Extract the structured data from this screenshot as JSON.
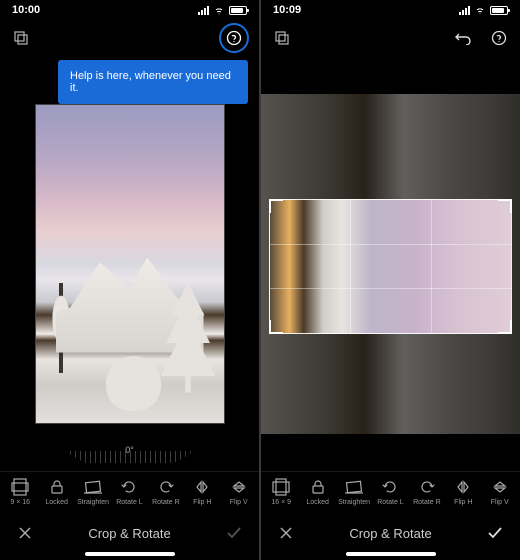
{
  "left": {
    "status_time": "10:00",
    "tooltip": "Help is here, whenever you need it.",
    "angle": "0°",
    "tools": [
      {
        "id": "aspect",
        "label": "9 × 16"
      },
      {
        "id": "locked",
        "label": "Locked"
      },
      {
        "id": "straighten",
        "label": "Straighten"
      },
      {
        "id": "rotate-l",
        "label": "Rotate L"
      },
      {
        "id": "rotate-r",
        "label": "Rotate R"
      },
      {
        "id": "flip-h",
        "label": "Flip H"
      },
      {
        "id": "flip-v",
        "label": "Flip V"
      }
    ],
    "mode_title": "Crop & Rotate"
  },
  "right": {
    "status_time": "10:09",
    "tools": [
      {
        "id": "aspect",
        "label": "16 × 9"
      },
      {
        "id": "locked",
        "label": "Locked"
      },
      {
        "id": "straighten",
        "label": "Straighten"
      },
      {
        "id": "rotate-l",
        "label": "Rotate L"
      },
      {
        "id": "rotate-r",
        "label": "Rotate R"
      },
      {
        "id": "flip-h",
        "label": "Flip H"
      },
      {
        "id": "flip-v",
        "label": "Flip V"
      }
    ],
    "mode_title": "Crop & Rotate"
  }
}
